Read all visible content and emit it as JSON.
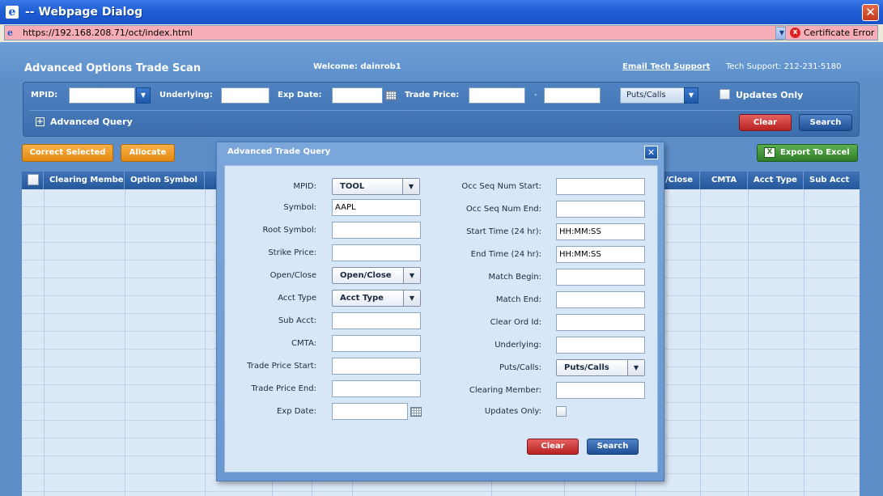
{
  "window": {
    "title": "-- Webpage Dialog",
    "close_glyph": "✕",
    "address": "https://192.168.208.71/oct/index.html",
    "certificate_error": "Certificate Error"
  },
  "header": {
    "app_title": "Advanced Options Trade Scan",
    "welcome": "Welcome: dainrob1",
    "email_support": "Email Tech Support",
    "tech_support": "Tech Support: 212-231-5180"
  },
  "search": {
    "mpid_label": "MPID:",
    "underlying_label": "Underlying:",
    "exp_date_label": "Exp Date:",
    "trade_price_label": "Trade Price:",
    "range_sep": "-",
    "puts_calls_value": "Puts/Calls",
    "updates_only_label": "Updates Only",
    "advanced_query_label": "Advanced Query",
    "clear_label": "Clear",
    "search_label": "Search"
  },
  "actions": {
    "correct_selected": "Correct Selected",
    "allocate": "Allocate",
    "export_excel": "Export To Excel"
  },
  "grid": {
    "columns": [
      "Clearing Membe",
      "Option Symbol",
      "/Close",
      "CMTA",
      "Acct Type",
      "Sub Acct"
    ]
  },
  "dialog": {
    "title": "Advanced Trade Query",
    "left_fields": {
      "mpid": {
        "label": "MPID:",
        "value": "TOOL"
      },
      "symbol": {
        "label": "Symbol:",
        "value": "AAPL"
      },
      "root_symbol": {
        "label": "Root Symbol:",
        "value": ""
      },
      "strike_price": {
        "label": "Strike Price:",
        "value": ""
      },
      "open_close": {
        "label": "Open/Close",
        "value": "Open/Close"
      },
      "acct_type": {
        "label": "Acct Type",
        "value": "Acct Type"
      },
      "sub_acct": {
        "label": "Sub Acct:",
        "value": ""
      },
      "cmta": {
        "label": "CMTA:",
        "value": ""
      },
      "trade_price_start": {
        "label": "Trade Price Start:",
        "value": ""
      },
      "trade_price_end": {
        "label": "Trade Price End:",
        "value": ""
      },
      "exp_date": {
        "label": "Exp Date:",
        "value": ""
      }
    },
    "right_fields": {
      "occ_seq_start": {
        "label": "Occ Seq Num Start:",
        "value": ""
      },
      "occ_seq_end": {
        "label": "Occ Seq Num End:",
        "value": ""
      },
      "start_time": {
        "label": "Start Time (24 hr):",
        "value": "HH:MM:SS"
      },
      "end_time": {
        "label": "End Time (24 hr):",
        "value": "HH:MM:SS"
      },
      "match_begin": {
        "label": "Match Begin:",
        "value": ""
      },
      "match_end": {
        "label": "Match End:",
        "value": ""
      },
      "clear_ord_id": {
        "label": "Clear Ord Id:",
        "value": ""
      },
      "underlying": {
        "label": "Underlying:",
        "value": ""
      },
      "puts_calls": {
        "label": "Puts/Calls:",
        "value": "Puts/Calls"
      },
      "clearing_member": {
        "label": "Clearing Member:",
        "value": ""
      },
      "updates_only": {
        "label": "Updates Only:",
        "checked": false
      }
    },
    "clear_label": "Clear",
    "search_label": "Search"
  },
  "icons": {
    "browser": "e",
    "dropdown": "▼",
    "plus": "+",
    "close": "✕",
    "excel": "X",
    "cert": "x"
  }
}
